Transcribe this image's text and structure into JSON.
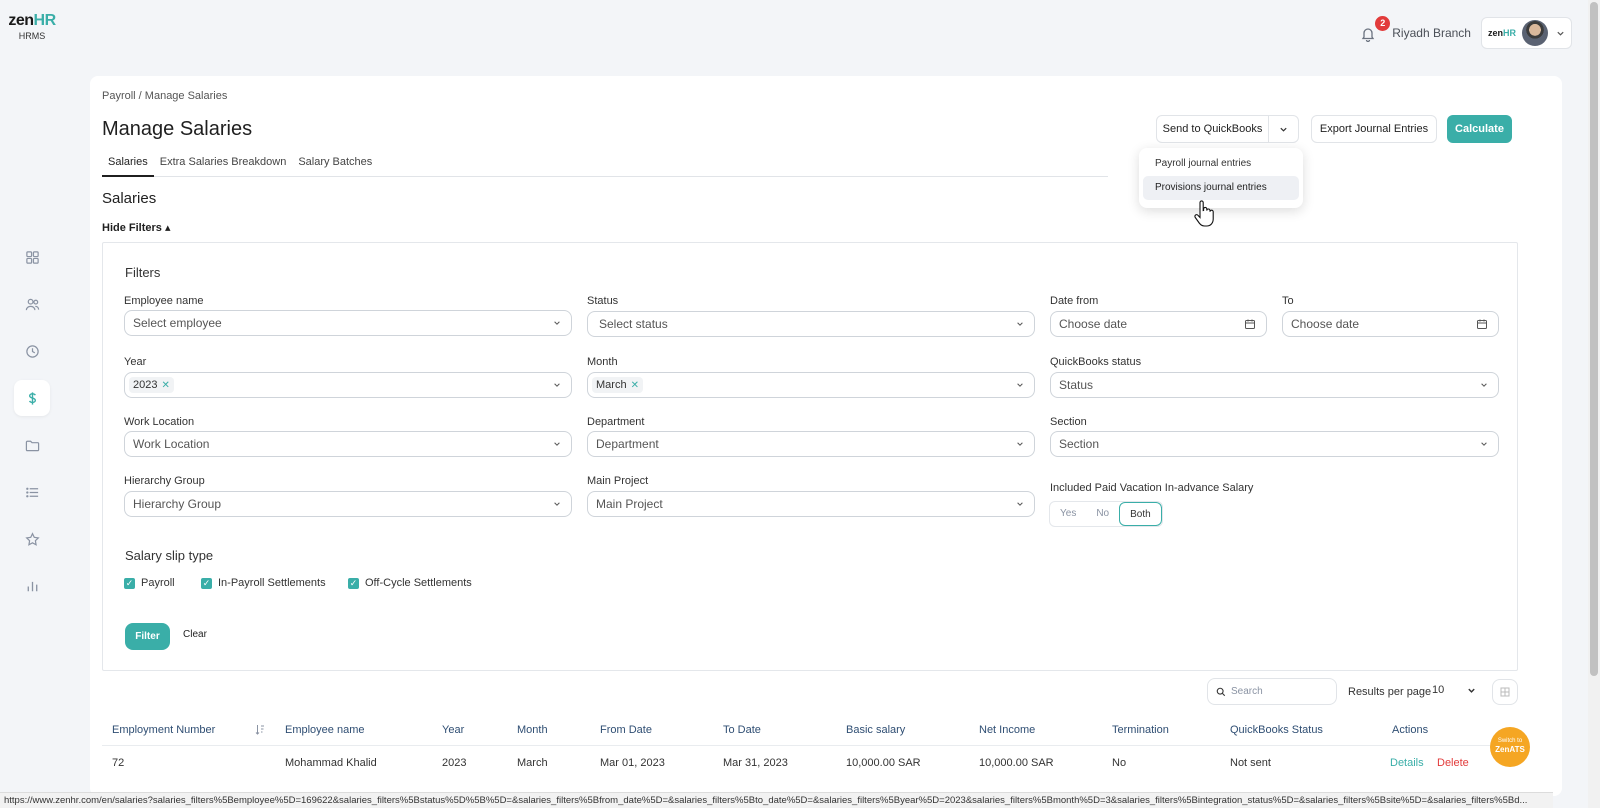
{
  "app": {
    "logo_main": "zen",
    "logo_accent": "HR",
    "logo_sub": "HRMS"
  },
  "sidebar": {
    "items": [
      {
        "name": "dashboard",
        "icon": "grid-icon"
      },
      {
        "name": "employees",
        "icon": "users-icon"
      },
      {
        "name": "attendance",
        "icon": "clock-icon"
      },
      {
        "name": "payroll",
        "icon": "dollar-icon",
        "active": true
      },
      {
        "name": "documents",
        "icon": "folder-icon"
      },
      {
        "name": "requests",
        "icon": "list-icon"
      },
      {
        "name": "performance",
        "icon": "star-icon"
      },
      {
        "name": "reports",
        "icon": "bar-chart-icon"
      }
    ]
  },
  "topbar": {
    "notification_count": "2",
    "branch": "Riyadh Branch",
    "mini_logo_main": "zen",
    "mini_logo_accent": "HR"
  },
  "page": {
    "breadcrumb": "Payroll / Manage Salaries",
    "title": "Manage Salaries",
    "tabs": [
      {
        "label": "Salaries",
        "active": true
      },
      {
        "label": "Extra Salaries Breakdown"
      },
      {
        "label": "Salary Batches"
      }
    ],
    "section_title": "Salaries",
    "hide_filters": "Hide Filters ▴"
  },
  "actions": {
    "send_quickbooks": "Send to QuickBooks",
    "export_journal": "Export Journal Entries",
    "calculate": "Calculate",
    "dropdown_items": [
      "Payroll journal entries",
      "Provisions journal entries"
    ]
  },
  "filters": {
    "title": "Filters",
    "employee_label": "Employee name",
    "employee_placeholder": "Select employee",
    "status_label": "Status",
    "status_placeholder": "Select status",
    "date_from_label": "Date from",
    "date_from_placeholder": "Choose date",
    "to_label": "To",
    "to_placeholder": "Choose date",
    "year_label": "Year",
    "year_value": "2023",
    "month_label": "Month",
    "month_value": "March",
    "qb_status_label": "QuickBooks status",
    "qb_status_placeholder": "Status",
    "work_location_label": "Work Location",
    "work_location_placeholder": "Work Location",
    "department_label": "Department",
    "department_placeholder": "Department",
    "section_label": "Section",
    "section_placeholder": "Section",
    "hierarchy_label": "Hierarchy Group",
    "hierarchy_placeholder": "Hierarchy Group",
    "main_project_label": "Main Project",
    "main_project_placeholder": "Main Project",
    "vacation_label": "Included Paid Vacation In-advance Salary",
    "vacation_options": [
      "Yes",
      "No",
      "Both"
    ],
    "vacation_selected": "Both",
    "slip_type_title": "Salary slip type",
    "slip_types": [
      "Payroll",
      "In-Payroll Settlements",
      "Off-Cycle Settlements"
    ],
    "filter_button": "Filter",
    "clear_button": "Clear"
  },
  "table": {
    "search_placeholder": "Search",
    "results_per_page_label": "Results per page",
    "results_per_page": "10",
    "columns": [
      "Employment Number",
      "Employee name",
      "Year",
      "Month",
      "From Date",
      "To Date",
      "Basic salary",
      "Net Income",
      "Termination",
      "QuickBooks Status",
      "Actions"
    ],
    "rows": [
      {
        "employment_number": "72",
        "employee_name": "Mohammad Khalid",
        "year": "2023",
        "month": "March",
        "from_date": "Mar 01, 2023",
        "to_date": "Mar 31, 2023",
        "basic_salary": "10,000.00 SAR",
        "net_income": "10,000.00 SAR",
        "termination": "No",
        "quickbooks_status": "Not sent",
        "details": "Details",
        "delete": "Delete"
      }
    ]
  },
  "switch_ats": {
    "line1": "Switch to",
    "line2": "ZenATS"
  },
  "status_url": "https://www.zenhr.com/en/salaries?salaries_filters%5Bemployee%5D=169622&salaries_filters%5Bstatus%5D%5B%5D=&salaries_filters%5Bfrom_date%5D=&salaries_filters%5Bto_date%5D=&salaries_filters%5Byear%5D=2023&salaries_filters%5Bmonth%5D=3&salaries_filters%5Bintegration_status%5D=&salaries_filters%5Bsite%5D=&salaries_filters%5Bd...",
  "colors": {
    "accent": "#3aaea8",
    "danger": "#e23b3b",
    "ats": "#f5a623"
  }
}
